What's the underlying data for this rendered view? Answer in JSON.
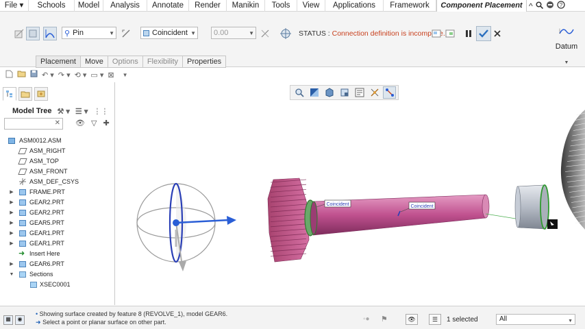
{
  "menubar": {
    "items": [
      "File",
      "Schools",
      "Model",
      "Analysis",
      "Annotate",
      "Render",
      "Manikin",
      "Tools",
      "View",
      "Applications",
      "Framework"
    ],
    "active_tab": "Component Placement"
  },
  "ribbon": {
    "constraint_type": "Pin",
    "constraint_option": "Coincident",
    "offset_value": "0.00",
    "status_label": "STATUS : ",
    "status_message": "Connection definition is incomplete.",
    "datum_label": "Datum",
    "tabs": [
      {
        "label": "Placement",
        "state": "active"
      },
      {
        "label": "Move",
        "state": "normal"
      },
      {
        "label": "Options",
        "state": "disabled"
      },
      {
        "label": "Flexibility",
        "state": "disabled"
      },
      {
        "label": "Properties",
        "state": "normal"
      }
    ]
  },
  "model_tree": {
    "title": "Model Tree",
    "search_value": "",
    "items": [
      {
        "label": "ASM0012.ASM",
        "icon": "assembly-icon",
        "level": 0,
        "expander": ""
      },
      {
        "label": "ASM_RIGHT",
        "icon": "datum-plane-icon",
        "level": 1,
        "expander": ""
      },
      {
        "label": "ASM_TOP",
        "icon": "datum-plane-icon",
        "level": 1,
        "expander": ""
      },
      {
        "label": "ASM_FRONT",
        "icon": "datum-plane-icon",
        "level": 1,
        "expander": ""
      },
      {
        "label": "ASM_DEF_CSYS",
        "icon": "csys-icon",
        "level": 1,
        "expander": ""
      },
      {
        "label": "FRAME.PRT",
        "icon": "part-icon",
        "level": 1,
        "expander": "▶"
      },
      {
        "label": "GEAR2.PRT",
        "icon": "part-icon",
        "level": 1,
        "expander": "▶"
      },
      {
        "label": "GEAR2.PRT",
        "icon": "part-icon",
        "level": 1,
        "expander": "▶"
      },
      {
        "label": "GEAR5.PRT",
        "icon": "part-icon",
        "level": 1,
        "expander": "▶"
      },
      {
        "label": "GEAR1.PRT",
        "icon": "part-icon",
        "level": 1,
        "expander": "▶"
      },
      {
        "label": "GEAR1.PRT",
        "icon": "part-icon",
        "level": 1,
        "expander": "▶"
      },
      {
        "label": "Insert Here",
        "icon": "insert-arrow-icon",
        "level": 1,
        "expander": ""
      },
      {
        "label": "GEAR6.PRT",
        "icon": "part-icon",
        "level": 1,
        "expander": "▶"
      },
      {
        "label": "Sections",
        "icon": "sections-icon",
        "level": 1,
        "expander": "▼"
      },
      {
        "label": "XSEC0001",
        "icon": "section-icon",
        "level": 2,
        "expander": ""
      }
    ]
  },
  "viewport": {
    "annotations": [
      "Coincident",
      "Coincident"
    ]
  },
  "statusbar": {
    "messages": [
      "Showing surface created by feature 8 (REVOLVE_1), model GEAR6.",
      "Select a point or planar surface on other part."
    ],
    "selection_count": "1 selected",
    "filter_value": "All"
  },
  "colors": {
    "part_magenta": "#c0518f",
    "status_red": "#c8401e",
    "accent_blue": "#2a5ed6"
  }
}
